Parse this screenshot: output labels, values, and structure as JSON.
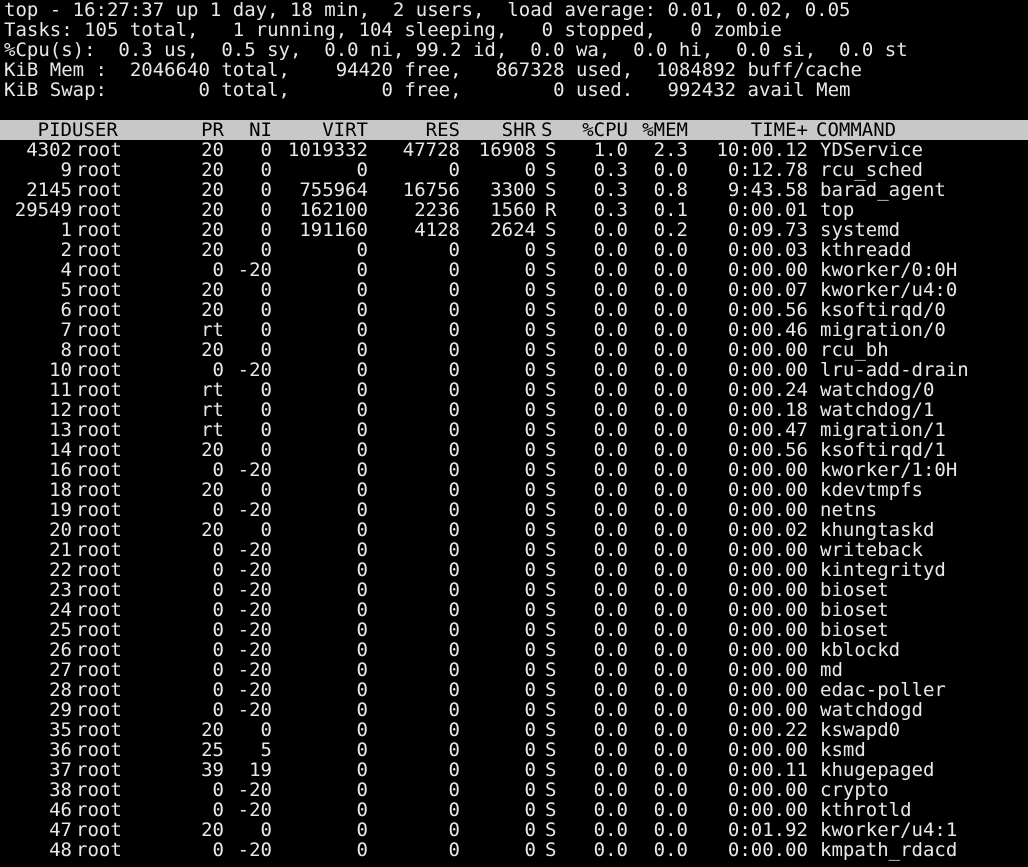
{
  "summary": {
    "line1": "top - 16:27:37 up 1 day, 18 min,  2 users,  load average: 0.01, 0.02, 0.05",
    "line2": "Tasks: 105 total,   1 running, 104 sleeping,   0 stopped,   0 zombie",
    "line3": "%Cpu(s):  0.3 us,  0.5 sy,  0.0 ni, 99.2 id,  0.0 wa,  0.0 hi,  0.0 si,  0.0 st",
    "line4": "KiB Mem :  2046640 total,    94420 free,   867328 used,  1084892 buff/cache",
    "line5": "KiB Swap:        0 total,        0 free,        0 used.   992432 avail Mem"
  },
  "columns": {
    "pid": "PID",
    "user": "USER",
    "pr": "PR",
    "ni": "NI",
    "virt": "VIRT",
    "res": "RES",
    "shr": "SHR",
    "s": "S",
    "cpu": "%CPU",
    "mem": "%MEM",
    "time": "TIME+",
    "command": "COMMAND"
  },
  "processes": [
    {
      "pid": "4302",
      "user": "root",
      "pr": "20",
      "ni": "0",
      "virt": "1019332",
      "res": "47728",
      "shr": "16908",
      "s": "S",
      "cpu": "1.0",
      "mem": "2.3",
      "time": "10:00.12",
      "command": "YDService"
    },
    {
      "pid": "9",
      "user": "root",
      "pr": "20",
      "ni": "0",
      "virt": "0",
      "res": "0",
      "shr": "0",
      "s": "S",
      "cpu": "0.3",
      "mem": "0.0",
      "time": "0:12.78",
      "command": "rcu_sched"
    },
    {
      "pid": "2145",
      "user": "root",
      "pr": "20",
      "ni": "0",
      "virt": "755964",
      "res": "16756",
      "shr": "3300",
      "s": "S",
      "cpu": "0.3",
      "mem": "0.8",
      "time": "9:43.58",
      "command": "barad_agent"
    },
    {
      "pid": "29549",
      "user": "root",
      "pr": "20",
      "ni": "0",
      "virt": "162100",
      "res": "2236",
      "shr": "1560",
      "s": "R",
      "cpu": "0.3",
      "mem": "0.1",
      "time": "0:00.01",
      "command": "top"
    },
    {
      "pid": "1",
      "user": "root",
      "pr": "20",
      "ni": "0",
      "virt": "191160",
      "res": "4128",
      "shr": "2624",
      "s": "S",
      "cpu": "0.0",
      "mem": "0.2",
      "time": "0:09.73",
      "command": "systemd"
    },
    {
      "pid": "2",
      "user": "root",
      "pr": "20",
      "ni": "0",
      "virt": "0",
      "res": "0",
      "shr": "0",
      "s": "S",
      "cpu": "0.0",
      "mem": "0.0",
      "time": "0:00.03",
      "command": "kthreadd"
    },
    {
      "pid": "4",
      "user": "root",
      "pr": "0",
      "ni": "-20",
      "virt": "0",
      "res": "0",
      "shr": "0",
      "s": "S",
      "cpu": "0.0",
      "mem": "0.0",
      "time": "0:00.00",
      "command": "kworker/0:0H"
    },
    {
      "pid": "5",
      "user": "root",
      "pr": "20",
      "ni": "0",
      "virt": "0",
      "res": "0",
      "shr": "0",
      "s": "S",
      "cpu": "0.0",
      "mem": "0.0",
      "time": "0:00.07",
      "command": "kworker/u4:0"
    },
    {
      "pid": "6",
      "user": "root",
      "pr": "20",
      "ni": "0",
      "virt": "0",
      "res": "0",
      "shr": "0",
      "s": "S",
      "cpu": "0.0",
      "mem": "0.0",
      "time": "0:00.56",
      "command": "ksoftirqd/0"
    },
    {
      "pid": "7",
      "user": "root",
      "pr": "rt",
      "ni": "0",
      "virt": "0",
      "res": "0",
      "shr": "0",
      "s": "S",
      "cpu": "0.0",
      "mem": "0.0",
      "time": "0:00.46",
      "command": "migration/0"
    },
    {
      "pid": "8",
      "user": "root",
      "pr": "20",
      "ni": "0",
      "virt": "0",
      "res": "0",
      "shr": "0",
      "s": "S",
      "cpu": "0.0",
      "mem": "0.0",
      "time": "0:00.00",
      "command": "rcu_bh"
    },
    {
      "pid": "10",
      "user": "root",
      "pr": "0",
      "ni": "-20",
      "virt": "0",
      "res": "0",
      "shr": "0",
      "s": "S",
      "cpu": "0.0",
      "mem": "0.0",
      "time": "0:00.00",
      "command": "lru-add-drain"
    },
    {
      "pid": "11",
      "user": "root",
      "pr": "rt",
      "ni": "0",
      "virt": "0",
      "res": "0",
      "shr": "0",
      "s": "S",
      "cpu": "0.0",
      "mem": "0.0",
      "time": "0:00.24",
      "command": "watchdog/0"
    },
    {
      "pid": "12",
      "user": "root",
      "pr": "rt",
      "ni": "0",
      "virt": "0",
      "res": "0",
      "shr": "0",
      "s": "S",
      "cpu": "0.0",
      "mem": "0.0",
      "time": "0:00.18",
      "command": "watchdog/1"
    },
    {
      "pid": "13",
      "user": "root",
      "pr": "rt",
      "ni": "0",
      "virt": "0",
      "res": "0",
      "shr": "0",
      "s": "S",
      "cpu": "0.0",
      "mem": "0.0",
      "time": "0:00.47",
      "command": "migration/1"
    },
    {
      "pid": "14",
      "user": "root",
      "pr": "20",
      "ni": "0",
      "virt": "0",
      "res": "0",
      "shr": "0",
      "s": "S",
      "cpu": "0.0",
      "mem": "0.0",
      "time": "0:00.56",
      "command": "ksoftirqd/1"
    },
    {
      "pid": "16",
      "user": "root",
      "pr": "0",
      "ni": "-20",
      "virt": "0",
      "res": "0",
      "shr": "0",
      "s": "S",
      "cpu": "0.0",
      "mem": "0.0",
      "time": "0:00.00",
      "command": "kworker/1:0H"
    },
    {
      "pid": "18",
      "user": "root",
      "pr": "20",
      "ni": "0",
      "virt": "0",
      "res": "0",
      "shr": "0",
      "s": "S",
      "cpu": "0.0",
      "mem": "0.0",
      "time": "0:00.00",
      "command": "kdevtmpfs"
    },
    {
      "pid": "19",
      "user": "root",
      "pr": "0",
      "ni": "-20",
      "virt": "0",
      "res": "0",
      "shr": "0",
      "s": "S",
      "cpu": "0.0",
      "mem": "0.0",
      "time": "0:00.00",
      "command": "netns"
    },
    {
      "pid": "20",
      "user": "root",
      "pr": "20",
      "ni": "0",
      "virt": "0",
      "res": "0",
      "shr": "0",
      "s": "S",
      "cpu": "0.0",
      "mem": "0.0",
      "time": "0:00.02",
      "command": "khungtaskd"
    },
    {
      "pid": "21",
      "user": "root",
      "pr": "0",
      "ni": "-20",
      "virt": "0",
      "res": "0",
      "shr": "0",
      "s": "S",
      "cpu": "0.0",
      "mem": "0.0",
      "time": "0:00.00",
      "command": "writeback"
    },
    {
      "pid": "22",
      "user": "root",
      "pr": "0",
      "ni": "-20",
      "virt": "0",
      "res": "0",
      "shr": "0",
      "s": "S",
      "cpu": "0.0",
      "mem": "0.0",
      "time": "0:00.00",
      "command": "kintegrityd"
    },
    {
      "pid": "23",
      "user": "root",
      "pr": "0",
      "ni": "-20",
      "virt": "0",
      "res": "0",
      "shr": "0",
      "s": "S",
      "cpu": "0.0",
      "mem": "0.0",
      "time": "0:00.00",
      "command": "bioset"
    },
    {
      "pid": "24",
      "user": "root",
      "pr": "0",
      "ni": "-20",
      "virt": "0",
      "res": "0",
      "shr": "0",
      "s": "S",
      "cpu": "0.0",
      "mem": "0.0",
      "time": "0:00.00",
      "command": "bioset"
    },
    {
      "pid": "25",
      "user": "root",
      "pr": "0",
      "ni": "-20",
      "virt": "0",
      "res": "0",
      "shr": "0",
      "s": "S",
      "cpu": "0.0",
      "mem": "0.0",
      "time": "0:00.00",
      "command": "bioset"
    },
    {
      "pid": "26",
      "user": "root",
      "pr": "0",
      "ni": "-20",
      "virt": "0",
      "res": "0",
      "shr": "0",
      "s": "S",
      "cpu": "0.0",
      "mem": "0.0",
      "time": "0:00.00",
      "command": "kblockd"
    },
    {
      "pid": "27",
      "user": "root",
      "pr": "0",
      "ni": "-20",
      "virt": "0",
      "res": "0",
      "shr": "0",
      "s": "S",
      "cpu": "0.0",
      "mem": "0.0",
      "time": "0:00.00",
      "command": "md"
    },
    {
      "pid": "28",
      "user": "root",
      "pr": "0",
      "ni": "-20",
      "virt": "0",
      "res": "0",
      "shr": "0",
      "s": "S",
      "cpu": "0.0",
      "mem": "0.0",
      "time": "0:00.00",
      "command": "edac-poller"
    },
    {
      "pid": "29",
      "user": "root",
      "pr": "0",
      "ni": "-20",
      "virt": "0",
      "res": "0",
      "shr": "0",
      "s": "S",
      "cpu": "0.0",
      "mem": "0.0",
      "time": "0:00.00",
      "command": "watchdogd"
    },
    {
      "pid": "35",
      "user": "root",
      "pr": "20",
      "ni": "0",
      "virt": "0",
      "res": "0",
      "shr": "0",
      "s": "S",
      "cpu": "0.0",
      "mem": "0.0",
      "time": "0:00.22",
      "command": "kswapd0"
    },
    {
      "pid": "36",
      "user": "root",
      "pr": "25",
      "ni": "5",
      "virt": "0",
      "res": "0",
      "shr": "0",
      "s": "S",
      "cpu": "0.0",
      "mem": "0.0",
      "time": "0:00.00",
      "command": "ksmd"
    },
    {
      "pid": "37",
      "user": "root",
      "pr": "39",
      "ni": "19",
      "virt": "0",
      "res": "0",
      "shr": "0",
      "s": "S",
      "cpu": "0.0",
      "mem": "0.0",
      "time": "0:00.11",
      "command": "khugepaged"
    },
    {
      "pid": "38",
      "user": "root",
      "pr": "0",
      "ni": "-20",
      "virt": "0",
      "res": "0",
      "shr": "0",
      "s": "S",
      "cpu": "0.0",
      "mem": "0.0",
      "time": "0:00.00",
      "command": "crypto"
    },
    {
      "pid": "46",
      "user": "root",
      "pr": "0",
      "ni": "-20",
      "virt": "0",
      "res": "0",
      "shr": "0",
      "s": "S",
      "cpu": "0.0",
      "mem": "0.0",
      "time": "0:00.00",
      "command": "kthrotld"
    },
    {
      "pid": "47",
      "user": "root",
      "pr": "20",
      "ni": "0",
      "virt": "0",
      "res": "0",
      "shr": "0",
      "s": "S",
      "cpu": "0.0",
      "mem": "0.0",
      "time": "0:01.92",
      "command": "kworker/u4:1"
    },
    {
      "pid": "48",
      "user": "root",
      "pr": "0",
      "ni": "-20",
      "virt": "0",
      "res": "0",
      "shr": "0",
      "s": "S",
      "cpu": "0.0",
      "mem": "0.0",
      "time": "0:00.00",
      "command": "kmpath_rdacd"
    }
  ],
  "colors": {
    "background": "#000000",
    "foreground": "#e8e8e8",
    "header_background": "#c8c8c8",
    "header_foreground": "#000000"
  }
}
